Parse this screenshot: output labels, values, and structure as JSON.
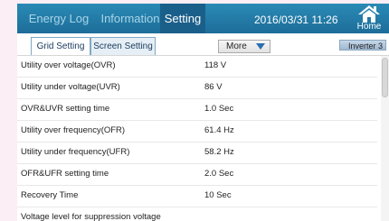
{
  "topbar": {
    "tabs": [
      {
        "label": "Energy Log"
      },
      {
        "label": "Information"
      },
      {
        "label": "Setting"
      }
    ],
    "datetime": "2016/03/31 11:26",
    "home_label": "Home"
  },
  "subbar": {
    "tabs": [
      {
        "label": "Grid Setting"
      },
      {
        "label": "Screen Setting"
      }
    ],
    "more_label": "More",
    "inverter_label": "Inverter 3"
  },
  "settings": [
    {
      "label": "Utility over voltage(OVR)",
      "value": "118  V"
    },
    {
      "label": "Utility under voltage(UVR)",
      "value": "86  V"
    },
    {
      "label": "OVR&UVR setting time",
      "value": "1.0  Sec"
    },
    {
      "label": "Utility over frequency(OFR)",
      "value": "61.4  Hz"
    },
    {
      "label": "Utility under frequency(UFR)",
      "value": "58.2  Hz"
    },
    {
      "label": "OFR&UFR setting time",
      "value": "2.0  Sec"
    },
    {
      "label": "Recovery Time",
      "value": "10  Sec"
    },
    {
      "label": "Voltage level for suppression voltage",
      "value": ""
    }
  ],
  "colors": {
    "topbar": "#1d6d99",
    "active_tab": "#1a5f8a",
    "page_background": "#fbeef4"
  },
  "icons": {
    "home": "home-icon",
    "more": "triangle-down-icon"
  }
}
